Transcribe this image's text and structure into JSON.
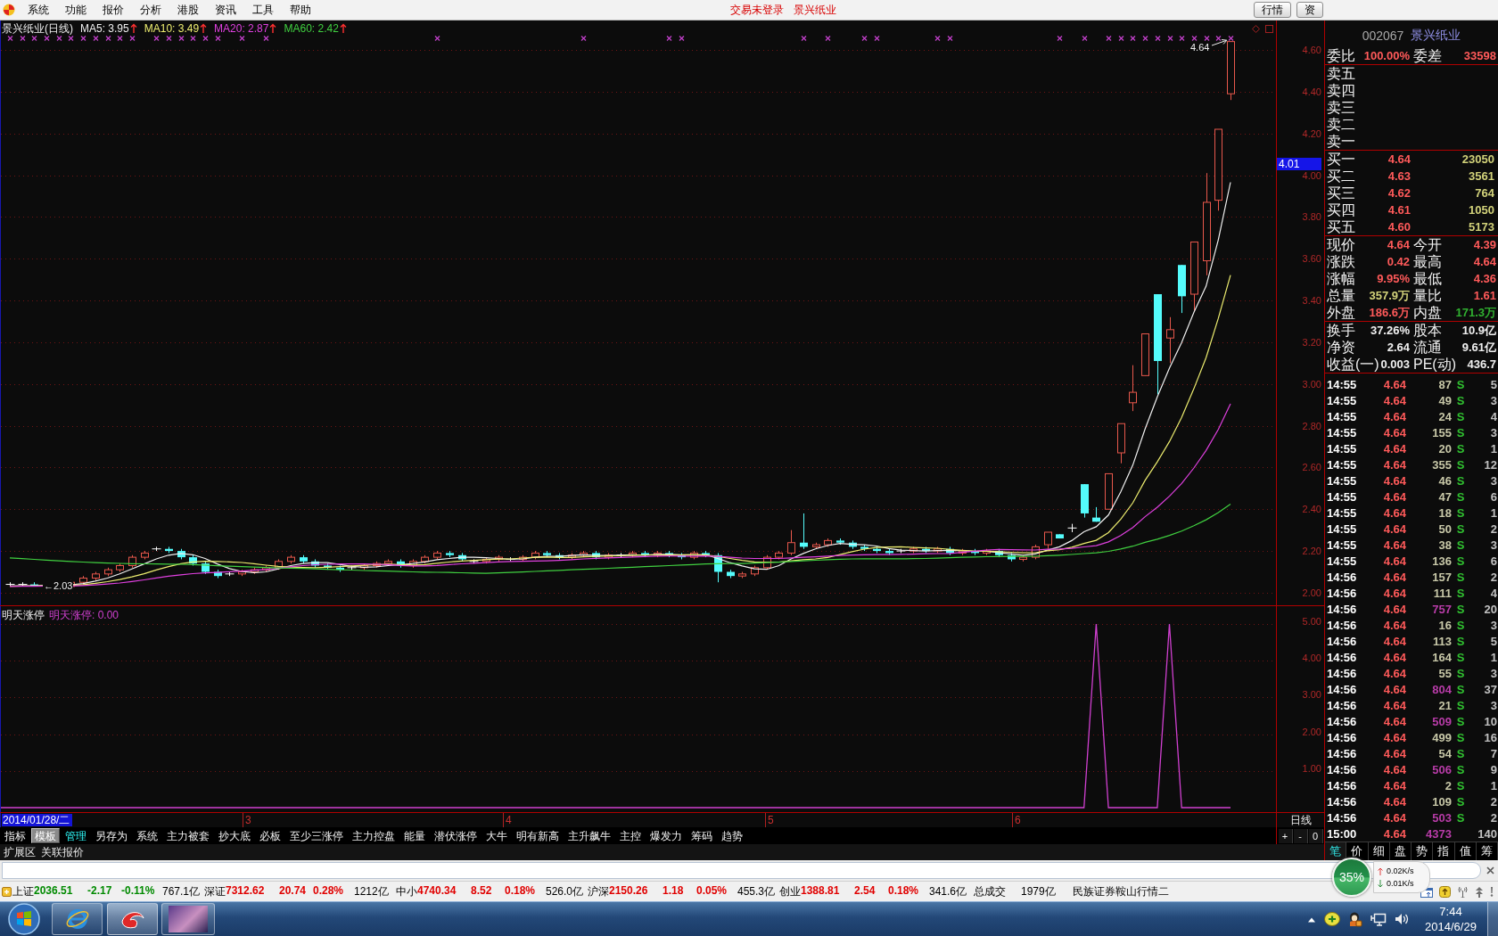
{
  "menu_bar": {
    "items": [
      "系统",
      "功能",
      "报价",
      "分析",
      "港股",
      "资讯",
      "工具",
      "帮助"
    ],
    "login_status": "交易未登录",
    "stock_name": "景兴纸业",
    "buttons": [
      "行情",
      "资"
    ]
  },
  "chart": {
    "title": "景兴纸业(日线)",
    "moving_averages": [
      {
        "label": "MA5: 3.95",
        "rising": true,
        "color": "#f0f0f0"
      },
      {
        "label": "MA10: 3.49",
        "rising": true,
        "color": "#eeee70"
      },
      {
        "label": "MA20: 2.87",
        "rising": true,
        "color": "#e040e0"
      },
      {
        "label": "MA60: 2.42",
        "rising": true,
        "color": "#40d040"
      }
    ],
    "price_axis": [
      "4.60",
      "4.40",
      "4.20",
      "4.00",
      "3.80",
      "3.60",
      "3.40",
      "3.20",
      "3.00",
      "2.80",
      "2.60",
      "2.40",
      "2.20",
      "2.00"
    ],
    "cursor_price": "4.01",
    "high_label": "4.64",
    "low_label": "←2.03"
  },
  "indicator": {
    "name": "明天涨停",
    "value_label": "明天涨停: 0.00",
    "axis": [
      "5.00",
      "4.00",
      "3.00",
      "2.00",
      "1.00"
    ]
  },
  "time_axis": {
    "date_label": "2014/01/28/二",
    "months": [
      "3",
      "4",
      "5",
      "6"
    ],
    "period": "日线"
  },
  "toolbar": {
    "tabs": [
      {
        "label": "指标",
        "selected": false,
        "highlighted": false
      },
      {
        "label": "模板",
        "selected": true,
        "highlighted": false
      },
      {
        "label": "管理",
        "selected": false,
        "highlighted": true
      },
      {
        "label": "另存为",
        "selected": false,
        "highlighted": false
      },
      {
        "label": "系统",
        "selected": false,
        "highlighted": false
      },
      {
        "label": "主力被套",
        "selected": false,
        "highlighted": false
      },
      {
        "label": "抄大底",
        "selected": false,
        "highlighted": false
      },
      {
        "label": "必板",
        "selected": false,
        "highlighted": false
      },
      {
        "label": "至少三涨停",
        "selected": false,
        "highlighted": false
      },
      {
        "label": "主力控盘",
        "selected": false,
        "highlighted": false
      },
      {
        "label": "能量",
        "selected": false,
        "highlighted": false
      },
      {
        "label": "潜伏涨停",
        "selected": false,
        "highlighted": false
      },
      {
        "label": "大牛",
        "selected": false,
        "highlighted": false
      },
      {
        "label": "明有新高",
        "selected": false,
        "highlighted": false
      },
      {
        "label": "主升飙牛",
        "selected": false,
        "highlighted": false
      },
      {
        "label": "主控",
        "selected": false,
        "highlighted": false
      },
      {
        "label": "爆发力",
        "selected": false,
        "highlighted": false
      },
      {
        "label": "筹码",
        "selected": false,
        "highlighted": false
      },
      {
        "label": "趋势",
        "selected": false,
        "highlighted": false
      }
    ],
    "zoom_buttons": [
      "+",
      "-",
      "0"
    ],
    "extra_tabs": [
      "扩展区",
      "关联报价"
    ]
  },
  "quote_panel": {
    "code": "002067",
    "name": "景兴纸业",
    "order_ratio": {
      "label": "委比",
      "value": "100.00%"
    },
    "order_diff": {
      "label": "委差",
      "value": "33598"
    },
    "asks": [
      "卖五",
      "卖四",
      "卖三",
      "卖二",
      "卖一"
    ],
    "bids": [
      {
        "label": "买一",
        "price": "4.64",
        "volume": "23050"
      },
      {
        "label": "买二",
        "price": "4.63",
        "volume": "3561"
      },
      {
        "label": "买三",
        "price": "4.62",
        "volume": "764"
      },
      {
        "label": "买四",
        "price": "4.61",
        "volume": "1050"
      },
      {
        "label": "买五",
        "price": "4.60",
        "volume": "5173"
      }
    ],
    "quotes": [
      {
        "label": "现价",
        "value": "4.64",
        "color": "#ff5a5a"
      },
      {
        "label": "今开",
        "value": "4.39",
        "color": "#ff5a5a"
      },
      {
        "label": "涨跌",
        "value": "0.42",
        "color": "#ff5a5a"
      },
      {
        "label": "最高",
        "value": "4.64",
        "color": "#ff5a5a"
      },
      {
        "label": "涨幅",
        "value": "9.95%",
        "color": "#ff5a5a"
      },
      {
        "label": "最低",
        "value": "4.36",
        "color": "#ff5a5a"
      },
      {
        "label": "总量",
        "value": "357.9万",
        "color": "#d2d27a"
      },
      {
        "label": "量比",
        "value": "1.61",
        "color": "#ff5a5a"
      },
      {
        "label": "外盘",
        "value": "186.6万",
        "color": "#ff5a5a"
      },
      {
        "label": "内盘",
        "value": "171.3万",
        "color": "#30b030"
      }
    ],
    "fundamentals": [
      {
        "label": "换手",
        "value": "37.26%"
      },
      {
        "label": "股本",
        "value": "10.9亿"
      },
      {
        "label": "净资",
        "value": "2.64"
      },
      {
        "label": "流通",
        "value": "9.61亿"
      },
      {
        "label": "收益(一)",
        "value": "0.003"
      },
      {
        "label": "PE(动)",
        "value": "436.7"
      }
    ],
    "ticks": [
      {
        "time": "14:55",
        "price": "4.64",
        "volume": "87",
        "big": false,
        "side": "S",
        "count": "5"
      },
      {
        "time": "14:55",
        "price": "4.64",
        "volume": "49",
        "big": false,
        "side": "S",
        "count": "3"
      },
      {
        "time": "14:55",
        "price": "4.64",
        "volume": "24",
        "big": false,
        "side": "S",
        "count": "4"
      },
      {
        "time": "14:55",
        "price": "4.64",
        "volume": "155",
        "big": false,
        "side": "S",
        "count": "3"
      },
      {
        "time": "14:55",
        "price": "4.64",
        "volume": "20",
        "big": false,
        "side": "S",
        "count": "1"
      },
      {
        "time": "14:55",
        "price": "4.64",
        "volume": "355",
        "big": false,
        "side": "S",
        "count": "12"
      },
      {
        "time": "14:55",
        "price": "4.64",
        "volume": "46",
        "big": false,
        "side": "S",
        "count": "3"
      },
      {
        "time": "14:55",
        "price": "4.64",
        "volume": "47",
        "big": false,
        "side": "S",
        "count": "6"
      },
      {
        "time": "14:55",
        "price": "4.64",
        "volume": "18",
        "big": false,
        "side": "S",
        "count": "1"
      },
      {
        "time": "14:55",
        "price": "4.64",
        "volume": "50",
        "big": false,
        "side": "S",
        "count": "2"
      },
      {
        "time": "14:55",
        "price": "4.64",
        "volume": "38",
        "big": false,
        "side": "S",
        "count": "3"
      },
      {
        "time": "14:55",
        "price": "4.64",
        "volume": "136",
        "big": false,
        "side": "S",
        "count": "6"
      },
      {
        "time": "14:56",
        "price": "4.64",
        "volume": "157",
        "big": false,
        "side": "S",
        "count": "2"
      },
      {
        "time": "14:56",
        "price": "4.64",
        "volume": "111",
        "big": false,
        "side": "S",
        "count": "4"
      },
      {
        "time": "14:56",
        "price": "4.64",
        "volume": "757",
        "big": true,
        "side": "S",
        "count": "20"
      },
      {
        "time": "14:56",
        "price": "4.64",
        "volume": "16",
        "big": false,
        "side": "S",
        "count": "3"
      },
      {
        "time": "14:56",
        "price": "4.64",
        "volume": "113",
        "big": false,
        "side": "S",
        "count": "5"
      },
      {
        "time": "14:56",
        "price": "4.64",
        "volume": "164",
        "big": false,
        "side": "S",
        "count": "1"
      },
      {
        "time": "14:56",
        "price": "4.64",
        "volume": "55",
        "big": false,
        "side": "S",
        "count": "3"
      },
      {
        "time": "14:56",
        "price": "4.64",
        "volume": "804",
        "big": true,
        "side": "S",
        "count": "37"
      },
      {
        "time": "14:56",
        "price": "4.64",
        "volume": "21",
        "big": false,
        "side": "S",
        "count": "3"
      },
      {
        "time": "14:56",
        "price": "4.64",
        "volume": "509",
        "big": true,
        "side": "S",
        "count": "10"
      },
      {
        "time": "14:56",
        "price": "4.64",
        "volume": "499",
        "big": false,
        "side": "S",
        "count": "16"
      },
      {
        "time": "14:56",
        "price": "4.64",
        "volume": "54",
        "big": false,
        "side": "S",
        "count": "7"
      },
      {
        "time": "14:56",
        "price": "4.64",
        "volume": "506",
        "big": true,
        "side": "S",
        "count": "9"
      },
      {
        "time": "14:56",
        "price": "4.64",
        "volume": "2",
        "big": false,
        "side": "S",
        "count": "1"
      },
      {
        "time": "14:56",
        "price": "4.64",
        "volume": "109",
        "big": false,
        "side": "S",
        "count": "2"
      },
      {
        "time": "14:56",
        "price": "4.64",
        "volume": "503",
        "big": true,
        "side": "S",
        "count": "2"
      },
      {
        "time": "15:00",
        "price": "4.64",
        "volume": "4373",
        "big": true,
        "count": "140"
      }
    ],
    "tabs": [
      {
        "label": "笔",
        "selected": true
      },
      {
        "label": "价",
        "selected": false
      },
      {
        "label": "细",
        "selected": false
      },
      {
        "label": "盘",
        "selected": false
      },
      {
        "label": "势",
        "selected": false
      },
      {
        "label": "指",
        "selected": false
      },
      {
        "label": "值",
        "selected": false
      },
      {
        "label": "筹",
        "selected": false
      }
    ]
  },
  "status_bar": {
    "indices": [
      {
        "name": "上证",
        "value": "2036.51",
        "change": "-2.17",
        "percent": "-0.11%",
        "amount": "767.1亿",
        "rising": false
      },
      {
        "name": "深证",
        "value": "7312.62",
        "change": "20.74",
        "percent": "0.28%",
        "amount": "1212亿",
        "rising": true
      },
      {
        "name": "中小",
        "value": "4740.34",
        "change": "8.52",
        "percent": "0.18%",
        "amount": "526.0亿",
        "rising": true
      },
      {
        "name": "沪深",
        "value": "2150.26",
        "change": "1.18",
        "percent": "0.05%",
        "amount": "455.3亿",
        "rising": true
      },
      {
        "name": "创业",
        "value": "1388.81",
        "change": "2.54",
        "percent": "0.18%",
        "amount": "341.6亿",
        "rising": true
      }
    ],
    "total_label": "总成交",
    "total": "1979亿",
    "server": "民族证券鞍山行情二"
  },
  "speed_widget": {
    "load": "35%",
    "upload": "0.02K/s",
    "download": "0.01K/s"
  },
  "taskbar": {
    "time": "7:44",
    "date": "2014/6/29"
  }
}
